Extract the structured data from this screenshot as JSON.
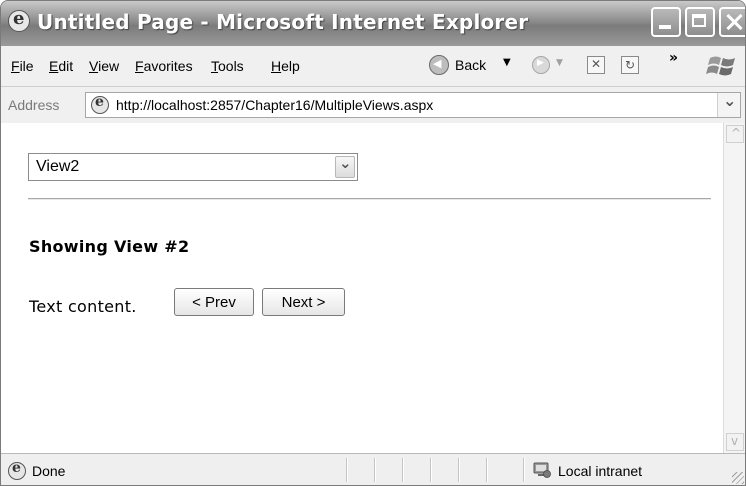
{
  "window": {
    "title": "Untitled Page - Microsoft Internet Explorer"
  },
  "menu": {
    "items": [
      "File",
      "Edit",
      "View",
      "Favorites",
      "Tools",
      "Help"
    ]
  },
  "toolbar": {
    "back_label": "Back",
    "more": "»"
  },
  "address": {
    "label": "Address",
    "url": "http://localhost:2857/Chapter16/MultipleViews.aspx"
  },
  "page": {
    "view_select": {
      "selected": "View2"
    },
    "heading": "Showing View #2",
    "text": "Text content.",
    "prev_label": "< Prev",
    "next_label": "Next >"
  },
  "status": {
    "text": "Done",
    "zone": "Local intranet"
  },
  "colors": {
    "titlebar": "#8c8c8c",
    "chrome": "#f0f0f0",
    "content": "#ffffff"
  }
}
